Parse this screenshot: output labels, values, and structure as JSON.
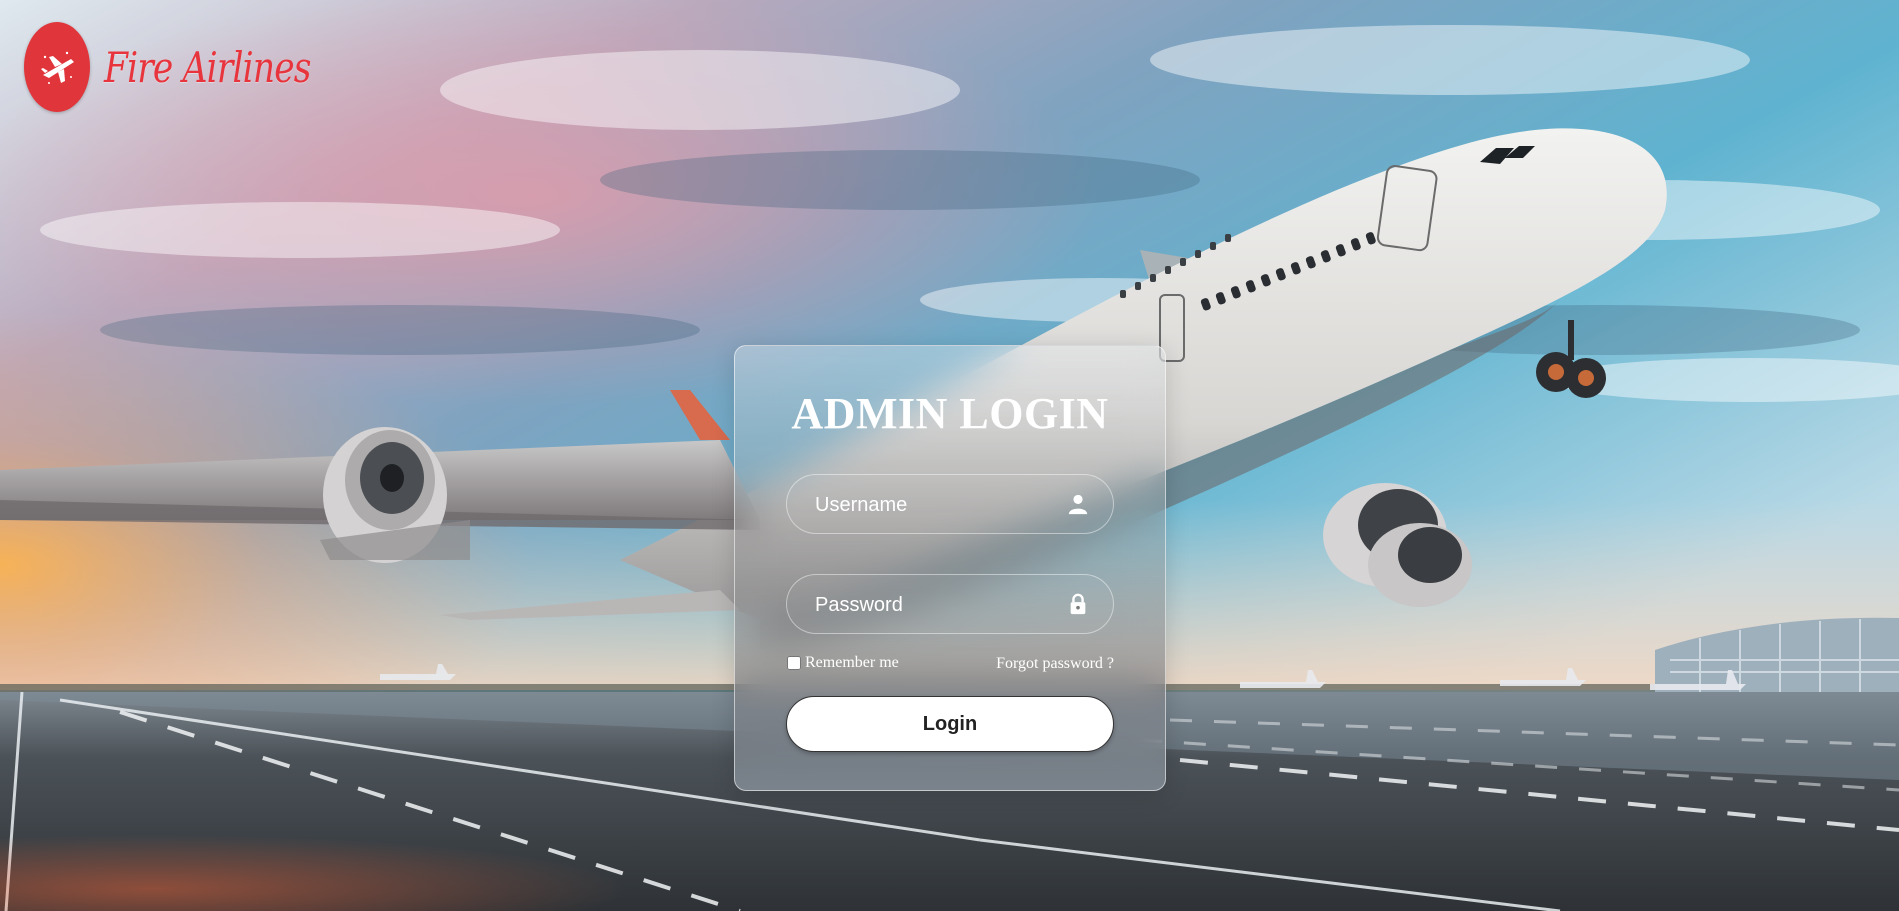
{
  "brand": {
    "name": "Fire Airlines",
    "accent_color": "#e0353b",
    "logo_icon": "airplane-icon"
  },
  "login": {
    "title": "ADMIN LOGIN",
    "username_placeholder": "Username",
    "username_icon": "user-icon",
    "password_placeholder": "Password",
    "password_icon": "lock-icon",
    "remember_label": "Remember me",
    "remember_checked": false,
    "forgot_label": "Forgot password ?",
    "submit_label": "Login"
  },
  "background": {
    "description_icon": "airplane-runway-photo"
  }
}
